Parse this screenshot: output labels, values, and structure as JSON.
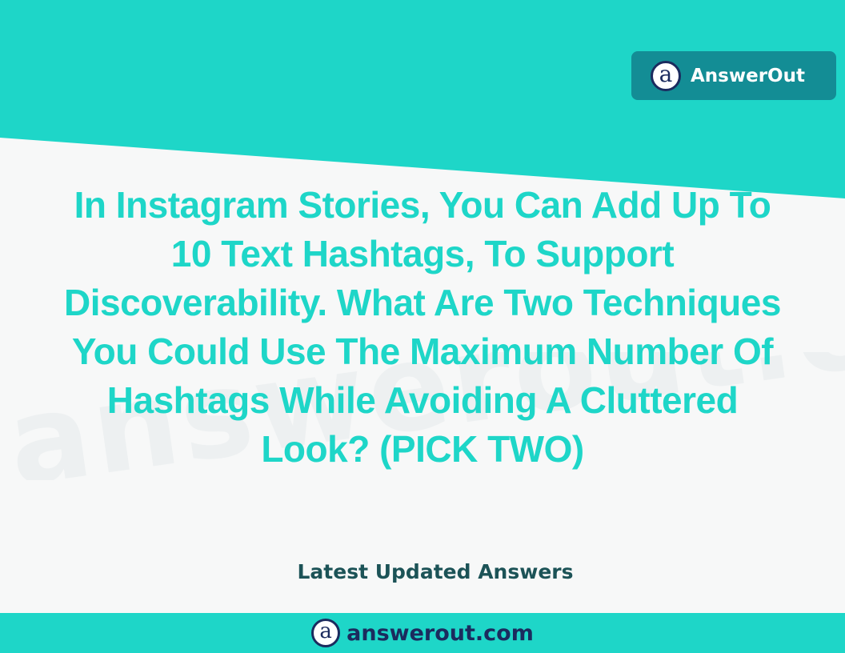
{
  "brand": {
    "name": "AnswerOut",
    "logo_glyph": "a"
  },
  "question": {
    "lines": [
      "In Instagram Stories, You Can Add Up To",
      "10 Text Hashtags, To Support",
      "Discoverability. What Are Two Techniques",
      "You Could Use The Maximum Number Of",
      "Hashtags While Avoiding A Cluttered",
      "Look? (PICK TWO)"
    ]
  },
  "watermark": {
    "text": "answerout.com"
  },
  "subtitle": "Latest Updated Answers",
  "footer": {
    "site": "answerout.com",
    "logo_glyph": "a"
  },
  "colors": {
    "teal": "#1ed6c8",
    "badge_bg": "#138d95",
    "navy": "#1b2b5e",
    "subtitle": "#1c5357",
    "background": "#f7f8f8"
  },
  "icons": {
    "brand_logo": "answerout-logo-icon",
    "footer_logo": "answerout-logo-icon"
  }
}
